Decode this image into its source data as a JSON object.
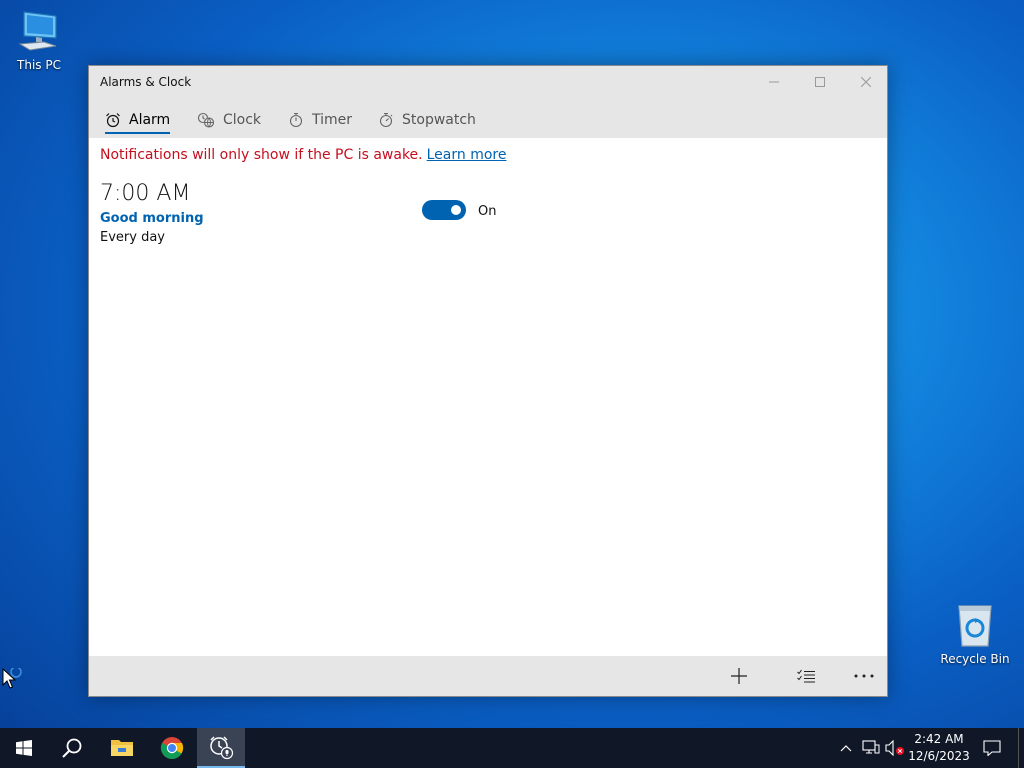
{
  "desktop": {
    "icons": [
      {
        "label": "This PC",
        "icon": "computer-icon"
      },
      {
        "label": "Recycle Bin",
        "icon": "recycle-bin-icon"
      }
    ]
  },
  "window": {
    "title": "Alarms & Clock",
    "tabs": [
      {
        "label": "Alarm",
        "icon": "alarm-clock-icon",
        "active": true
      },
      {
        "label": "Clock",
        "icon": "world-clock-icon",
        "active": false
      },
      {
        "label": "Timer",
        "icon": "timer-icon",
        "active": false
      },
      {
        "label": "Stopwatch",
        "icon": "stopwatch-icon",
        "active": false
      }
    ],
    "notice": {
      "text": "Notifications will only show if the PC is awake.",
      "link": "Learn more"
    },
    "alarms": [
      {
        "time": "7:00 AM",
        "name": "Good morning",
        "repeat": "Every day",
        "enabled": true,
        "toggle_label": "On"
      }
    ],
    "command_bar": [
      "add-icon",
      "select-alarms-icon",
      "more-icon"
    ]
  },
  "taskbar": {
    "apps": [
      "windows-start-icon",
      "search-icon",
      "file-explorer-icon",
      "chrome-icon",
      "alarms-clock-app-icon"
    ],
    "time": "2:42 AM",
    "date": "12/6/2023"
  },
  "colors": {
    "accent": "#0063b1",
    "warning": "#c50f1f",
    "chrome": "#e6e6e6",
    "taskbar": "#101828"
  }
}
